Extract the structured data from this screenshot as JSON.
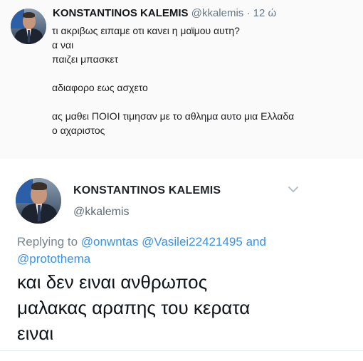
{
  "top_tweet": {
    "display_name": "KONSTANTINOS KALEMIS",
    "handle": "@kkalemis",
    "separator": "·",
    "time": "12 ώ",
    "lines": [
      "τι ακριβως ειπαμε οτι κανει η μαϊμου αυτη?",
      "α ναι",
      "παιζει μπασκετ",
      "",
      "αδιαφορο εως ασχετο",
      "",
      "ας μαθει ΠΟΙΟΙ τιμησαν με το αθλημα αυτο μια Ελλαδα",
      "ο αχαριστος"
    ]
  },
  "quoted_tweet": {
    "display_name": "KONSTANTINOS KALEMIS",
    "handle": "@kkalemis",
    "replying_prefix": "Replying to",
    "mentions": [
      "@onwntas",
      "@Vasilei22421495",
      "@protothema"
    ],
    "mention_conjunction": "and",
    "text_lines": [
      "και δεν ειναι ανθρωπος",
      "μαλακας αραπης του κερατα",
      "ειναι"
    ]
  },
  "icons": {
    "avatar": "profile-photo",
    "caret": "chevron-down-icon"
  },
  "colors": {
    "link": "#3b92e0",
    "secondary_text": "#657786",
    "top_background": "#fafafa"
  }
}
